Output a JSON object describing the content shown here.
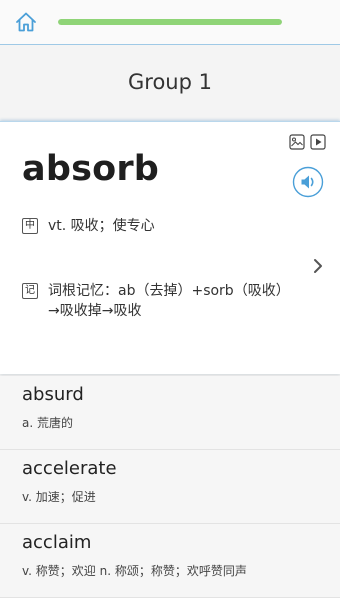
{
  "header": {
    "progress": 1.0
  },
  "group_title": "Group 1",
  "card": {
    "word": "absorb",
    "definition_tag": "中",
    "definition": "vt. 吸收；使专心",
    "memory_tag": "记",
    "memory": "词根记忆：ab（去掉）+sorb（吸收）→吸收掉→吸收"
  },
  "words": [
    {
      "word": "absurd",
      "def": "a. 荒唐的"
    },
    {
      "word": "accelerate",
      "def": "v. 加速；促进"
    },
    {
      "word": "acclaim",
      "def": "v. 称赞；欢迎 n. 称颂；称赞；欢呼赞同声"
    }
  ],
  "colors": {
    "accent": "#4a9fd8",
    "progress": "#8fd477"
  }
}
